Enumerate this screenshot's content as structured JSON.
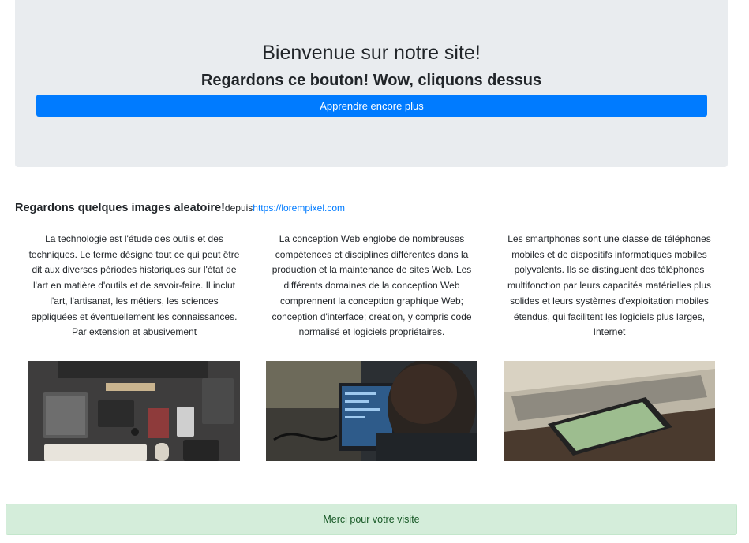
{
  "hero": {
    "title": "Bienvenue sur notre site!",
    "subtitle": "Regardons ce bouton! Wow, cliquons dessus",
    "button_label": "Apprendre encore plus"
  },
  "gallery": {
    "heading": "Regardons quelques images aleatoire!",
    "from_label": "depuis",
    "link_text": "https://lorempixel.com",
    "cards": [
      {
        "text": "La technologie est l'étude des outils et des techniques. Le terme désigne tout ce qui peut être dit aux diverses périodes historiques sur l'état de l'art en matière d'outils et de savoir-faire. Il inclut l'art, l'artisanat, les métiers, les sciences appliquées et éventuellement les connaissances. Par extension et abusivement"
      },
      {
        "text": "La conception Web englobe de nombreuses compétences et disciplines différentes dans la production et la maintenance de sites Web. Les différents domaines de la conception Web comprennent la conception graphique Web; conception d'interface; création, y compris code normalisé et logiciels propriétaires."
      },
      {
        "text": "Les smartphones sont une classe de téléphones mobiles et de dispositifs informatiques mobiles polyvalents. Ils se distinguent des téléphones multifonction par leurs capacités matérielles plus solides et leurs systèmes d'exploitation mobiles étendus, qui facilitent les logiciels plus larges, Internet"
      }
    ]
  },
  "footer": {
    "text": "Merci pour votre visite"
  },
  "colors": {
    "primary": "#007bff",
    "jumbotron_bg": "#e9ecef",
    "footer_bg": "#d4edda",
    "footer_text": "#155724"
  }
}
